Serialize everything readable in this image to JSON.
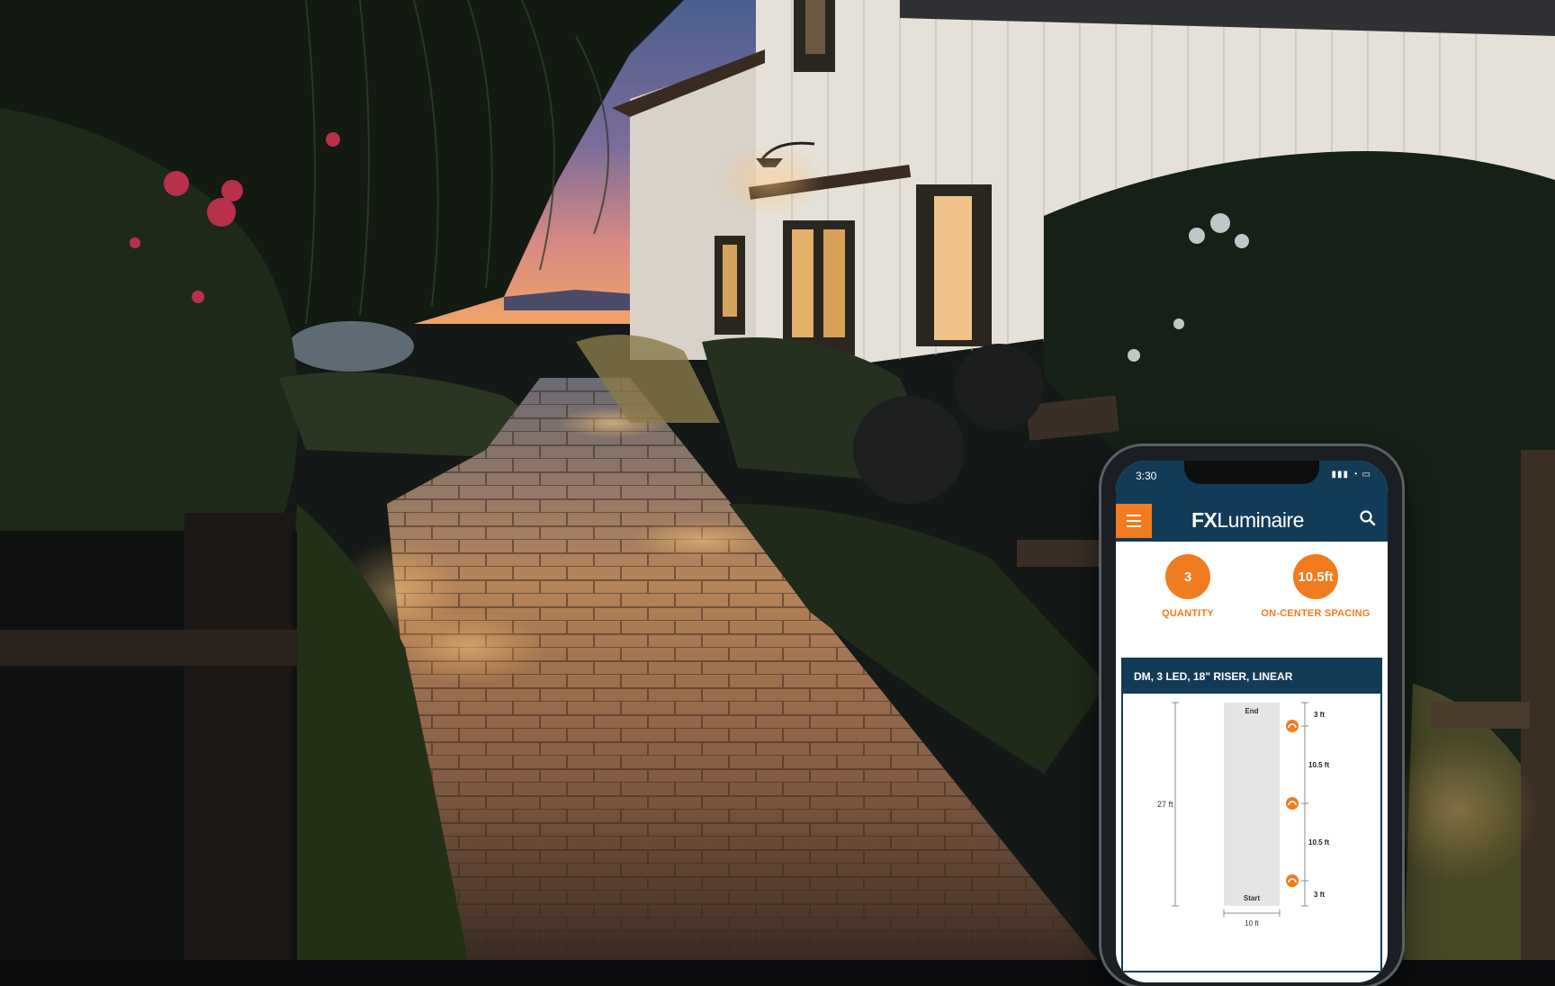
{
  "phone": {
    "status_time": "3:30",
    "status_icons": "▮▮▮ ◔ ▭",
    "app": {
      "logo_fx": "FX",
      "logo_rest": "Luminaire",
      "stats": [
        {
          "value": "3",
          "label": "QUANTITY"
        },
        {
          "value": "10.5ft",
          "label": "ON-CENTER SPACING"
        }
      ],
      "fixture_title": "DM, 3 LED, 18\" RISER, LINEAR",
      "diagram": {
        "end_label": "End",
        "start_label": "Start",
        "total_length": "27 ft",
        "width": "10 ft",
        "spacings": [
          "3 ft",
          "10.5 ft",
          "10.5 ft",
          "3 ft"
        ]
      }
    }
  },
  "colors": {
    "accent": "#f07c1f",
    "navy": "#123b57"
  }
}
